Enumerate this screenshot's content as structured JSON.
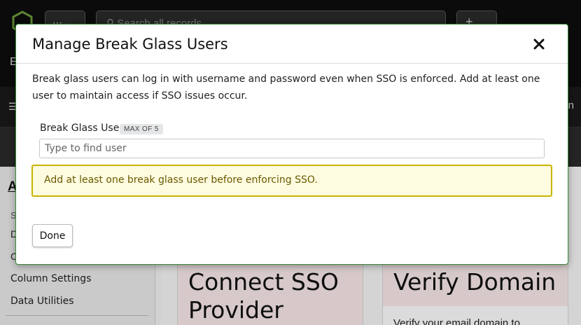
{
  "app": {
    "search_placeholder": "Search all records",
    "apps_icon": "grid-icon",
    "add_icon": "plus-icon",
    "top_letter": "E",
    "subnav_right": "n"
  },
  "sidebar": {
    "heading": "A",
    "section_letter": "S",
    "item_d": "D",
    "item_c": "C",
    "items": [
      {
        "label": "Column Settings"
      },
      {
        "label": "Data Utilities"
      }
    ]
  },
  "cards": [
    {
      "title": "Connect SSO Provider"
    },
    {
      "title": "Verify Domain",
      "body": "Verify your email domain to"
    }
  ],
  "modal": {
    "title": "Manage Break Glass Users",
    "close_icon": "close-icon",
    "description": "Break glass users can log in with username and password even when SSO is enforced. Add at least one user to maintain access if SSO issues occur.",
    "field_label": "Break Glass Users",
    "max_badge": "MAX OF 5",
    "input_placeholder": "Type to find user",
    "input_value": "",
    "alert_text": "Add at least one break glass user before enforcing SSO.",
    "alert_color": "#c8b400",
    "done_label": "Done",
    "border_color": "#3a8a3a"
  }
}
